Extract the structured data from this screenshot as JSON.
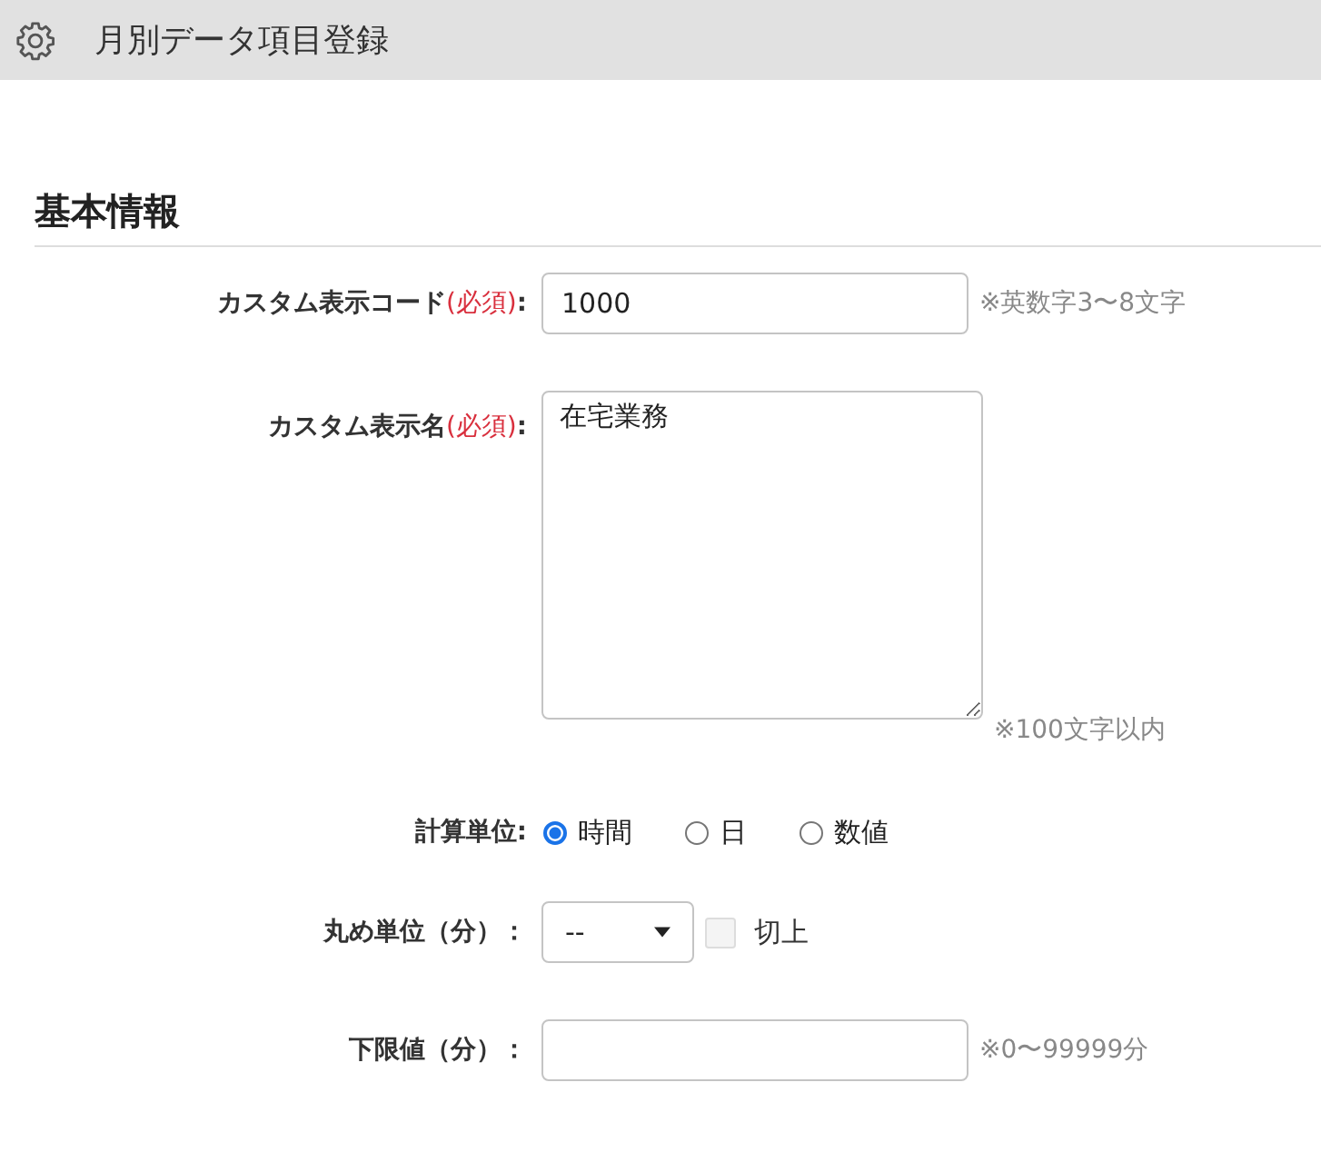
{
  "header": {
    "title": "月別データ項目登録"
  },
  "section": {
    "title": "基本情報"
  },
  "fields": [
    {
      "kind": "text",
      "label": "カスタム表示コード",
      "required": "(必須)",
      "colon": ":",
      "value": "1000",
      "hint": "※英数字3〜8文字"
    },
    {
      "kind": "textarea",
      "label": "カスタム表示名",
      "required": "(必須)",
      "colon": ":",
      "value": "在宅業務",
      "hint": "※100文字以内"
    },
    {
      "kind": "radio",
      "label": "計算単位",
      "colon": ":",
      "options": [
        {
          "label": "時間",
          "selected": true
        },
        {
          "label": "日",
          "selected": false
        },
        {
          "label": "数値",
          "selected": false
        }
      ]
    },
    {
      "kind": "select",
      "label": "丸め単位（分）",
      "colon": "：",
      "value": "--",
      "checkbox": {
        "label": "切上",
        "checked": false,
        "disabled": true
      }
    },
    {
      "kind": "text",
      "label": "下限値（分）",
      "colon": "：",
      "hint": "※0〜99999分"
    }
  ]
}
